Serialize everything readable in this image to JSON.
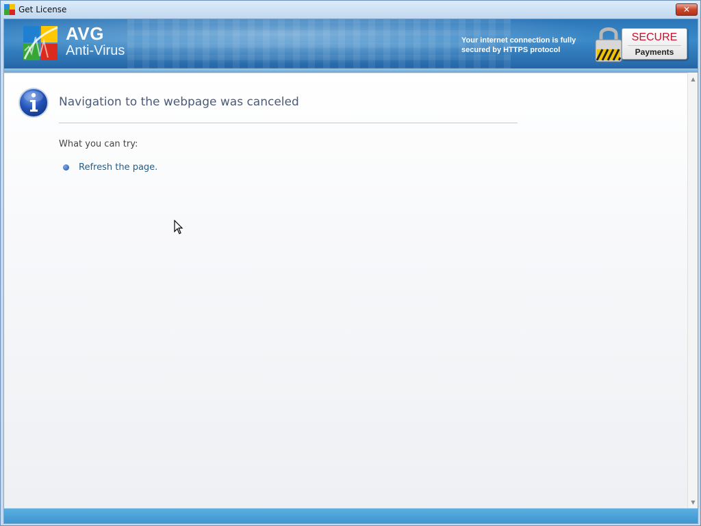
{
  "window": {
    "title": "Get License",
    "close_label": "✕"
  },
  "banner": {
    "brand_name": "AVG",
    "product_name": "Anti-Virus",
    "secure_note": "Your internet connection is fully secured by HTTPS protocol",
    "secure_badge_title": "SECURE",
    "secure_badge_subtitle": "Payments"
  },
  "page": {
    "heading": "Navigation to the webpage was canceled",
    "try_label": "What you can try:",
    "suggestions": [
      {
        "label": "Refresh the page."
      }
    ]
  },
  "icons": {
    "app": "avg-logo-icon",
    "info": "info-icon",
    "lock": "padlock-icon",
    "bullet": "bullet-icon",
    "cursor": "mouse-pointer-icon"
  },
  "colors": {
    "banner_blue": "#2c76b8",
    "secure_red": "#c8102e",
    "link_blue": "#1e5f8e",
    "heading_gray_blue": "#4a5a78"
  }
}
